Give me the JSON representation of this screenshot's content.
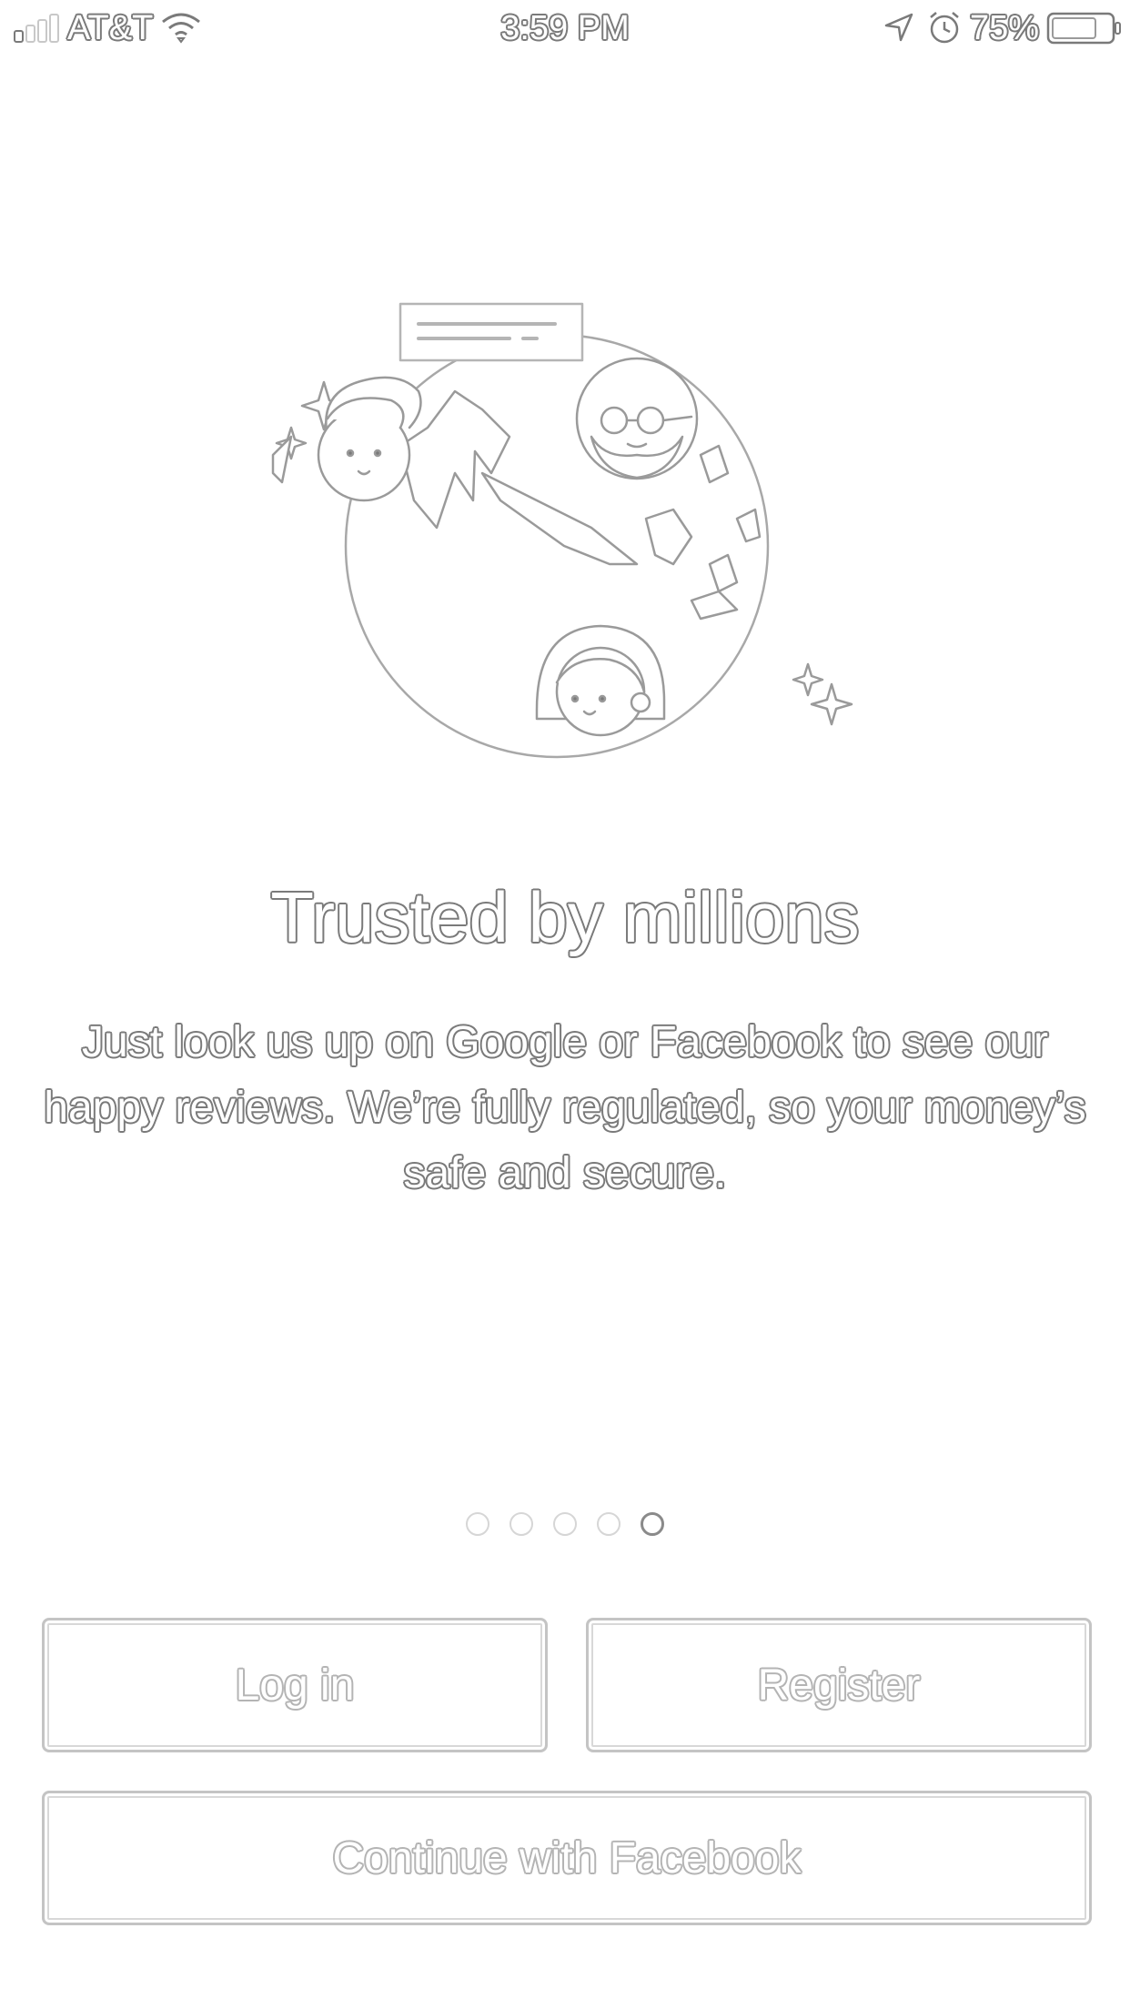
{
  "status_bar": {
    "carrier": "AT&T",
    "time": "3:59 PM",
    "battery_percent": "75%",
    "battery_level": 0.75,
    "signal_bars_filled": 1,
    "signal_bars_total": 4,
    "icons": [
      "signal-icon",
      "wifi-icon",
      "location-arrow-icon",
      "alarm-clock-icon",
      "battery-icon"
    ]
  },
  "onboarding": {
    "illustration": "globe-with-people-illustration",
    "title": "Trusted by millions",
    "body": "Just look us up on Google or Facebook to see our happy reviews. We’re fully regulated, so your money’s safe and secure.",
    "pager": {
      "total": 5,
      "current": 5
    }
  },
  "actions": {
    "login_label": "Log in",
    "register_label": "Register",
    "facebook_label": "Continue with Facebook"
  }
}
